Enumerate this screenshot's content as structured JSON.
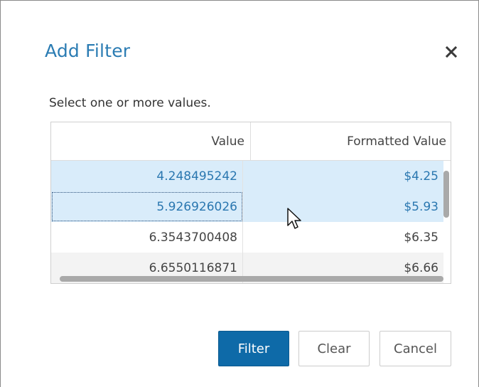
{
  "dialog": {
    "title": "Add Filter",
    "close_icon": "close-icon",
    "instructions": "Select one or more values."
  },
  "grid": {
    "columns": [
      "Value",
      "Formatted Value"
    ],
    "rows": [
      {
        "value": "4.248495242",
        "formatted": "$4.25",
        "selected": true
      },
      {
        "value": "5.926926026",
        "formatted": "$5.93",
        "selected": true
      },
      {
        "value": "6.3543700408",
        "formatted": "$6.35",
        "selected": false
      },
      {
        "value": "6.6550116871",
        "formatted": "$6.66",
        "selected": false
      }
    ]
  },
  "buttons": {
    "filter": "Filter",
    "clear": "Clear",
    "cancel": "Cancel"
  },
  "colors": {
    "title": "#2b7cb3",
    "primary_button": "#0e6aa8",
    "selected_row": "#d9ecfa",
    "selected_text": "#2a77b0"
  }
}
